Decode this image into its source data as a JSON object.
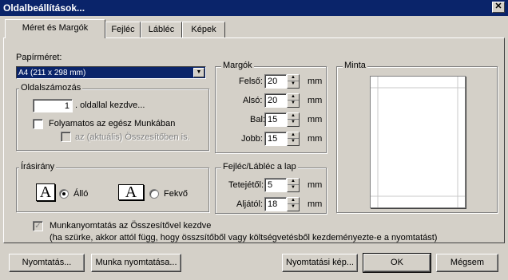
{
  "window": {
    "title": "Oldalbeállítások...",
    "close_glyph": "✕"
  },
  "tabs": [
    {
      "label": "Méret és Margók",
      "active": true
    },
    {
      "label": "Fejléc",
      "active": false
    },
    {
      "label": "Lábléc",
      "active": false
    },
    {
      "label": "Képek",
      "active": false
    }
  ],
  "paper": {
    "label": "Papírméret:",
    "value": "A4 (211 x 298 mm)"
  },
  "numbering": {
    "group_label": "Oldalszámozás",
    "start_value": "1",
    "start_label": ". oldallal kezdve...",
    "continuous_label": "Folyamatos az egész Munkában",
    "continuous_checked": false,
    "summary_label": "az (aktuális) Összesítőben is.",
    "summary_checked": false
  },
  "orientation": {
    "group_label": "Írásirány",
    "portrait_label": "Álló",
    "landscape_label": "Fekvő",
    "selected": "portrait",
    "icon_letter": "A"
  },
  "margins": {
    "group_label": "Margók",
    "unit": "mm",
    "top_label": "Felső:",
    "top_value": "20",
    "bottom_label": "Alsó:",
    "bottom_value": "20",
    "left_label": "Bal:",
    "left_value": "15",
    "right_label": "Jobb:",
    "right_value": "15"
  },
  "header_footer": {
    "group_label": "Fejléc/Lábléc a lap",
    "unit": "mm",
    "top_label": "Tetejétől:",
    "top_value": "5",
    "bottom_label": "Aljától:",
    "bottom_value": "18"
  },
  "preview": {
    "group_label": "Minta"
  },
  "summary_print": {
    "label": "Munkanyomtatás az Összesítővel kezdve",
    "checked": true,
    "note": "(ha szürke, akkor attól függ, hogy összsítőből vagy költségvetésből kezdeményezte-e a nyomtatást)"
  },
  "buttons": {
    "print": "Nyomtatás...",
    "work_print": "Munka nyomtatása...",
    "print_preview": "Nyomtatási kép...",
    "ok": "OK",
    "cancel": "Mégsem"
  }
}
